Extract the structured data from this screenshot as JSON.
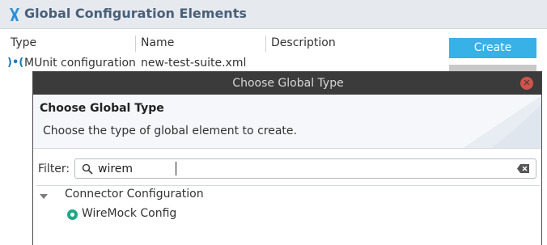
{
  "panel": {
    "title": "Global Configuration Elements",
    "icon": "mule-logo-icon",
    "columns": [
      "Type",
      "Name",
      "Description"
    ],
    "rows": [
      {
        "icon": "munit-icon",
        "icon_text": ")•(",
        "type": "MUnit configuration (",
        "name": "new-test-suite.xml",
        "description": ""
      }
    ],
    "create_label": "Create"
  },
  "dialog": {
    "window_title": "Choose Global Type",
    "heading": "Choose Global Type",
    "description": "Choose the type of global element to create.",
    "filter_label": "Filter:",
    "filter_value": "wirem",
    "tree": {
      "group": "Connector Configuration",
      "items": [
        "WireMock Config"
      ]
    }
  },
  "colors": {
    "header_bg": "#e6e9ee",
    "title_text": "#4a5f78",
    "create_button": "#37b1e6",
    "titlebar": "#3b3b3b",
    "close_button": "#d0544a",
    "wiremock_icon": "#1ea886"
  }
}
